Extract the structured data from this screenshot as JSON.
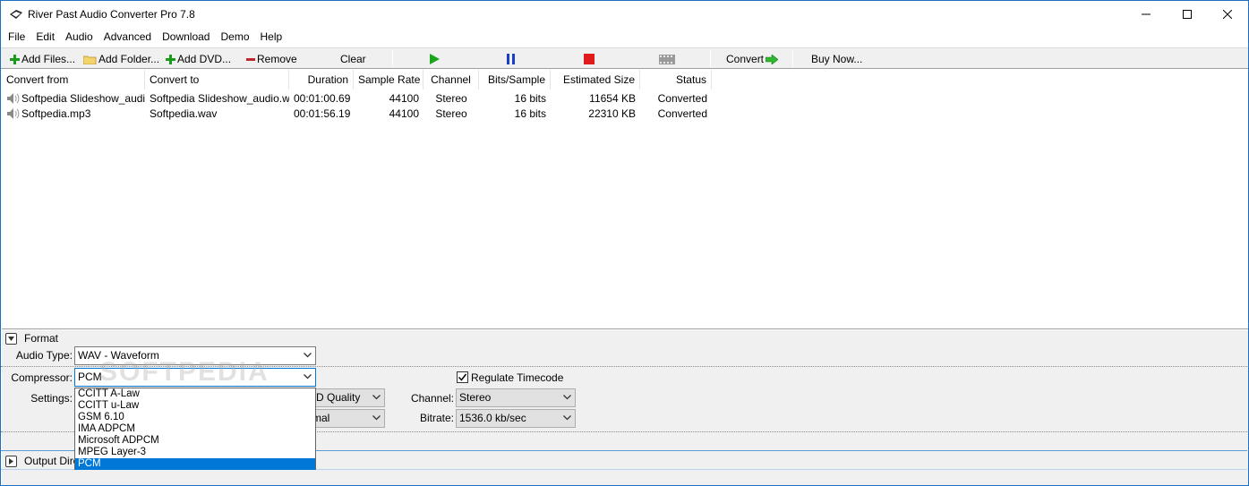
{
  "window": {
    "title": "River Past Audio Converter Pro 7.8"
  },
  "menu": [
    "File",
    "Edit",
    "Audio",
    "Advanced",
    "Download",
    "Demo",
    "Help"
  ],
  "toolbar": {
    "add_files": "Add Files...",
    "add_folder": "Add Folder...",
    "add_dvd": "Add DVD...",
    "remove": "Remove",
    "clear": "Clear",
    "convert": "Convert",
    "buy_now": "Buy Now..."
  },
  "grid": {
    "columns": [
      "Convert from",
      "Convert to",
      "Duration",
      "Sample Rate",
      "Channel",
      "Bits/Sample",
      "Estimated Size",
      "Status"
    ],
    "rows": [
      {
        "from": "Softpedia Slideshow_audi...",
        "to": "Softpedia Slideshow_audio.w...",
        "duration": "00:01:00.69",
        "sample_rate": "44100",
        "channel": "Stereo",
        "bits": "16 bits",
        "size": "11654 KB",
        "status": "Converted"
      },
      {
        "from": "Softpedia.mp3",
        "to": "Softpedia.wav",
        "duration": "00:01:56.19",
        "sample_rate": "44100",
        "channel": "Stereo",
        "bits": "16 bits",
        "size": "22310 KB",
        "status": "Converted"
      }
    ]
  },
  "format": {
    "section_title": "Format",
    "audio_type_label": "Audio Type:",
    "audio_type_value": "WAV - Waveform",
    "compressor_label": "Compressor:",
    "compressor_value": "PCM",
    "regulate_timecode_label": "Regulate Timecode",
    "settings_label": "Settings:",
    "quality_value": "VD Quality",
    "format_value": "rmal",
    "channel_label": "Channel:",
    "channel_value": "Stereo",
    "bitrate_label": "Bitrate:",
    "bitrate_value": "1536.0 kb/sec",
    "compressor_options": [
      "CCITT A-Law",
      "CCITT u-Law",
      "GSM 6.10",
      "IMA ADPCM",
      "Microsoft ADPCM",
      "MPEG Layer-3",
      "PCM"
    ],
    "compressor_selected_index": 6,
    "watermark": "SOFTPEDIA"
  },
  "output": {
    "section_title": "Output Dire"
  }
}
